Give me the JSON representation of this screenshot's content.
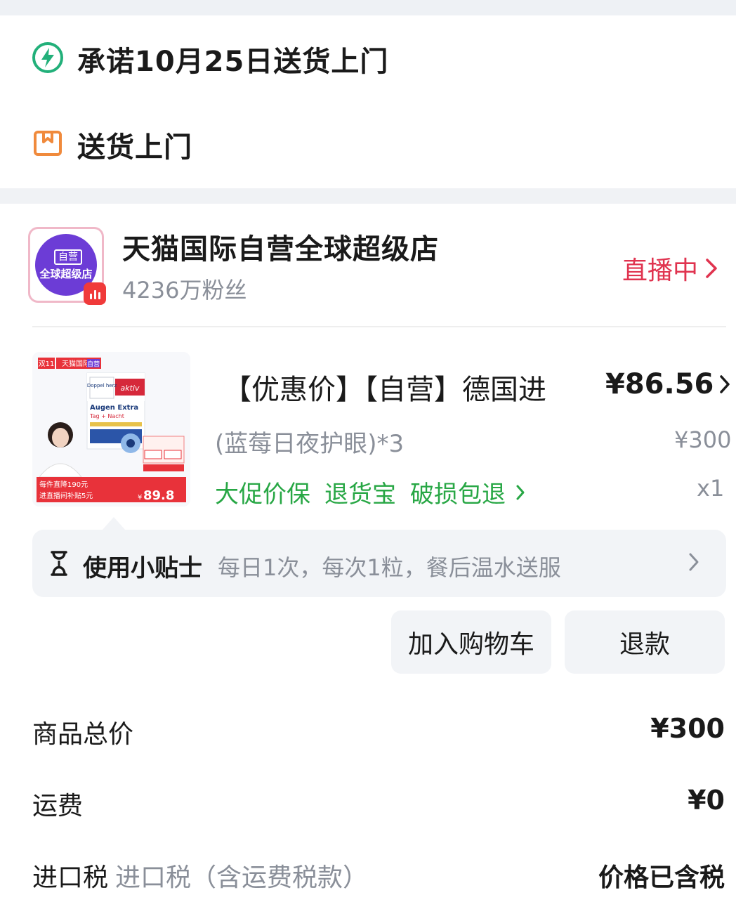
{
  "delivery": {
    "promise_text": "承诺10月25日送货上门",
    "method_text": "送货上门",
    "promise_icon": "lightning-icon",
    "method_icon": "package-icon"
  },
  "store": {
    "logo_line1": "自营",
    "logo_line2": "全球超级店",
    "name": "天猫国际自营全球超级店",
    "fans": "4236万粉丝",
    "live_label": "直播中"
  },
  "product_image": {
    "tag_double11": "双11",
    "tag_store": "天猫国际",
    "tag_self": "自营",
    "brand": "Doppel herz",
    "brand_sub": "aktiv",
    "name_line1": "Augen Extra",
    "name_line2": "Tag + Nacht",
    "promo_left1": "每件直降190元",
    "promo_left2": "进直播间补贴5元",
    "promo_price": "89.8",
    "promo_currency": "¥"
  },
  "product": {
    "title": "【优惠价】【自营】德国进",
    "variant": "(蓝莓日夜护眼)*3",
    "price": "¥86.56",
    "original_price": "¥300",
    "quantity": "x1",
    "services": [
      "大促价保",
      "退货宝",
      "破损包退"
    ]
  },
  "tips": {
    "label": "使用小贴士",
    "value": "每日1次，每次1粒，餐后温水送服"
  },
  "actions": {
    "add_to_cart": "加入购物车",
    "refund": "退款"
  },
  "summary": {
    "goods_total_label": "商品总价",
    "goods_total_value": "¥300",
    "shipping_label": "运费",
    "shipping_value": "¥0",
    "import_tax_label": "进口税",
    "import_tax_sub": "进口税（含运费税款）",
    "import_tax_value": "价格已含税"
  },
  "colors": {
    "accent_green": "#22b07a",
    "live_red": "#e0334f",
    "service_green": "#28a745",
    "store_purple": "#6c3cd6",
    "package_orange": "#f08a3c"
  }
}
